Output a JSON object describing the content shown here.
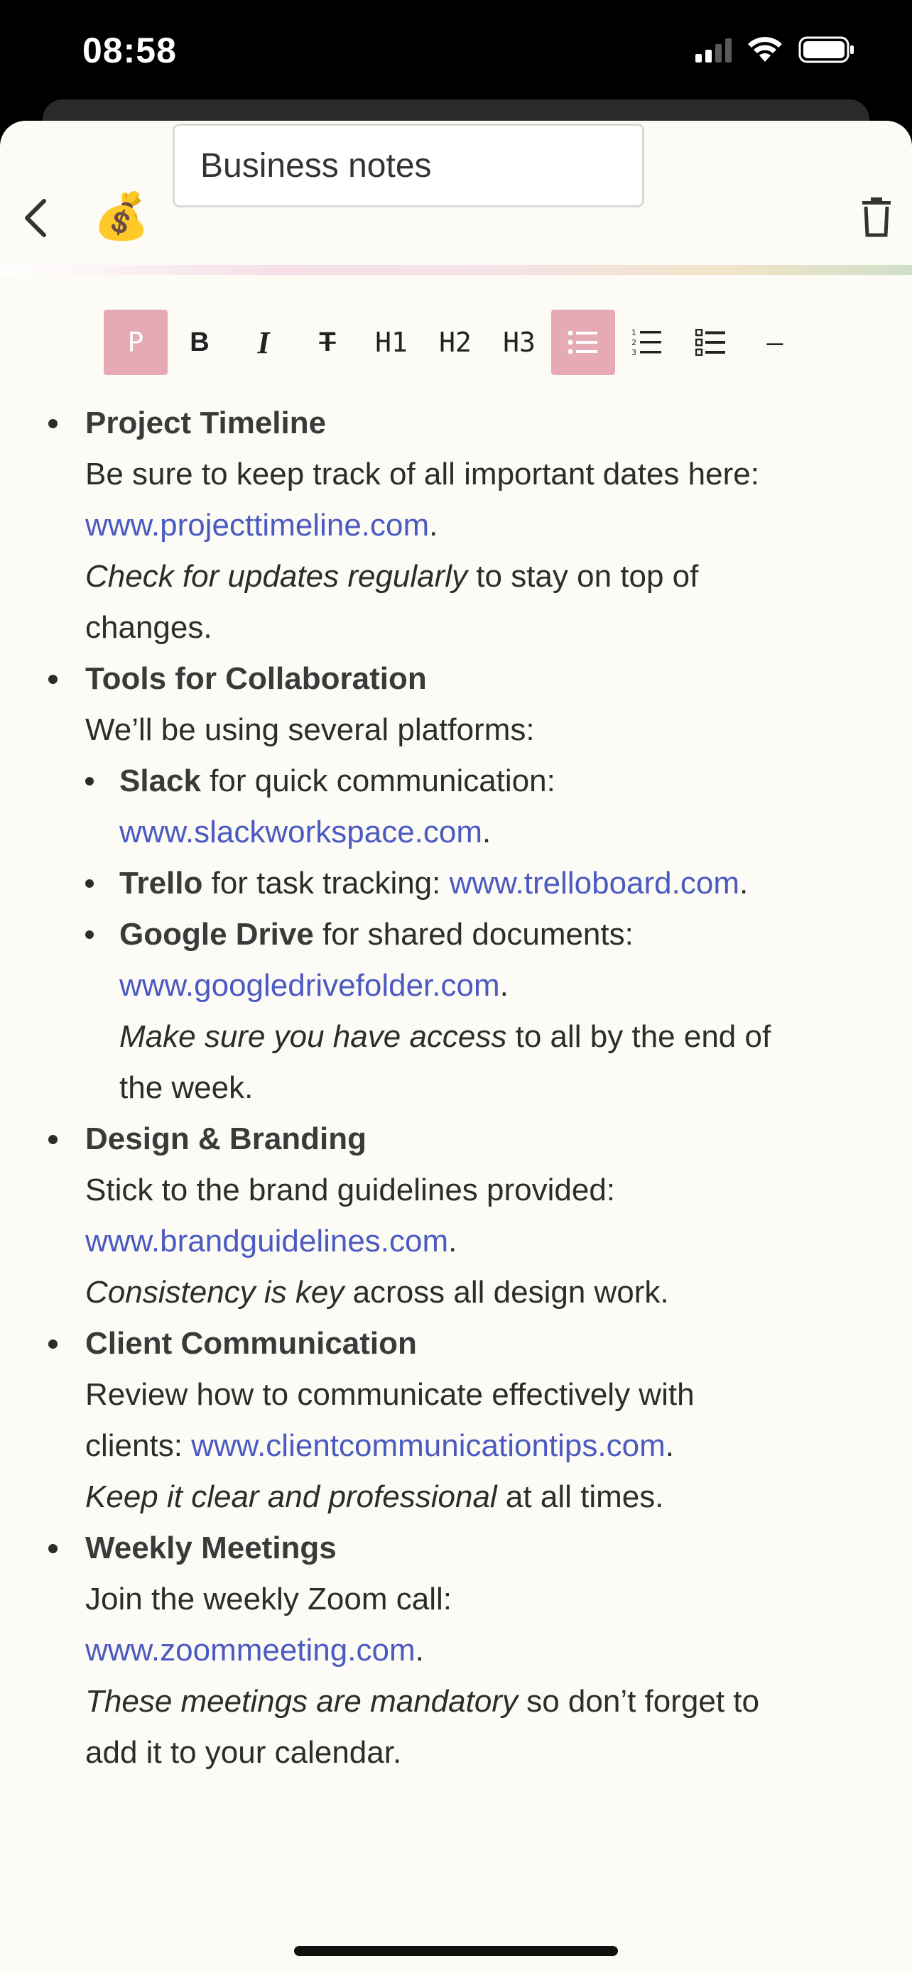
{
  "status": {
    "time": "08:58"
  },
  "header": {
    "emoji": "💰",
    "title_value": "Business notes"
  },
  "toolbar": {
    "p": "P",
    "bold": "B",
    "italic": "I",
    "strike": "T",
    "h1": "H1",
    "h2": "H2",
    "h3": "H3",
    "hr": "—"
  },
  "colors": {
    "accent": "#e6aab5",
    "link": "#4b5ac0",
    "background": "#fcfbf6"
  },
  "notes": {
    "s1": {
      "title": "Project Timeline",
      "text1": "Be sure to keep track of all important dates here:",
      "link": "www.projecttimeline.com",
      "em": "Check for updates regularly",
      "text2": " to stay on top of changes."
    },
    "s2": {
      "title": "Tools for Collaboration",
      "text1": "We’ll be using several platforms:",
      "slack": {
        "b": "Slack",
        "t": " for quick communication: ",
        "link": "www.slackworkspace.com"
      },
      "trello": {
        "b": "Trello",
        "t": " for task tracking: ",
        "link": "www.trelloboard.com"
      },
      "gdrive": {
        "b": "Google Drive",
        "t": " for shared documents: ",
        "link": "www.googledrivefolder.com",
        "em": "Make sure you have access",
        "t2": " to all by the end of the week."
      }
    },
    "s3": {
      "title": "Design & Branding",
      "text1": "Stick to the brand guidelines provided:",
      "link": "www.brandguidelines.com",
      "em": "Consistency is key",
      "text2": " across all design work."
    },
    "s4": {
      "title": "Client Communication",
      "text1": "Review how to communicate effectively with clients: ",
      "link": "www.clientcommunicationtips.com",
      "em": "Keep it clear and professional",
      "text2": " at all times."
    },
    "s5": {
      "title": "Weekly Meetings",
      "text1": "Join the weekly Zoom call:",
      "link": "www.zoommeeting.com",
      "em": "These meetings are mandatory",
      "text2": " so don’t forget to add it to your calendar."
    }
  }
}
